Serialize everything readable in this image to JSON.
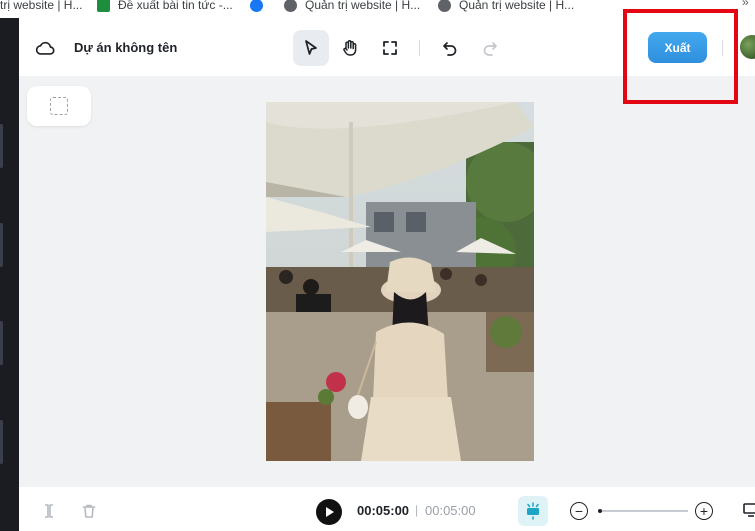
{
  "bookmarks": [
    {
      "label": "trị website | H...",
      "icon": "site-globe-icon"
    },
    {
      "label": "Đề xuất bài tin tức -...",
      "icon": "sheet-icon"
    },
    {
      "label": "",
      "icon": "facebook-icon"
    },
    {
      "label": "Quản trị website | H...",
      "icon": "site-globe-icon"
    },
    {
      "label": "Quản trị website | H...",
      "icon": "site-globe-icon"
    }
  ],
  "bookmarks_more": "»",
  "project": {
    "title": "Dự án không tên"
  },
  "toolbar": {
    "tools": [
      "select-cursor-icon",
      "hand-pan-icon",
      "fit-frame-icon",
      "undo-icon",
      "redo-icon"
    ],
    "active_tool": "select-cursor-icon"
  },
  "export": {
    "label": "Xuất"
  },
  "colors": {
    "accent": "#3a9be6",
    "highlight": "#e30613",
    "canvas_bg": "#f1f2f4",
    "rail": "#1b1b22"
  },
  "playback": {
    "current": "00:05:00",
    "separator": "|",
    "total": "00:05:00",
    "zoom_level": 0.04
  },
  "bottom_tools": [
    "split-icon",
    "trash-icon",
    "play-icon",
    "tracks-icon",
    "zoom-out-icon",
    "zoom-in-icon",
    "screen-icon"
  ]
}
